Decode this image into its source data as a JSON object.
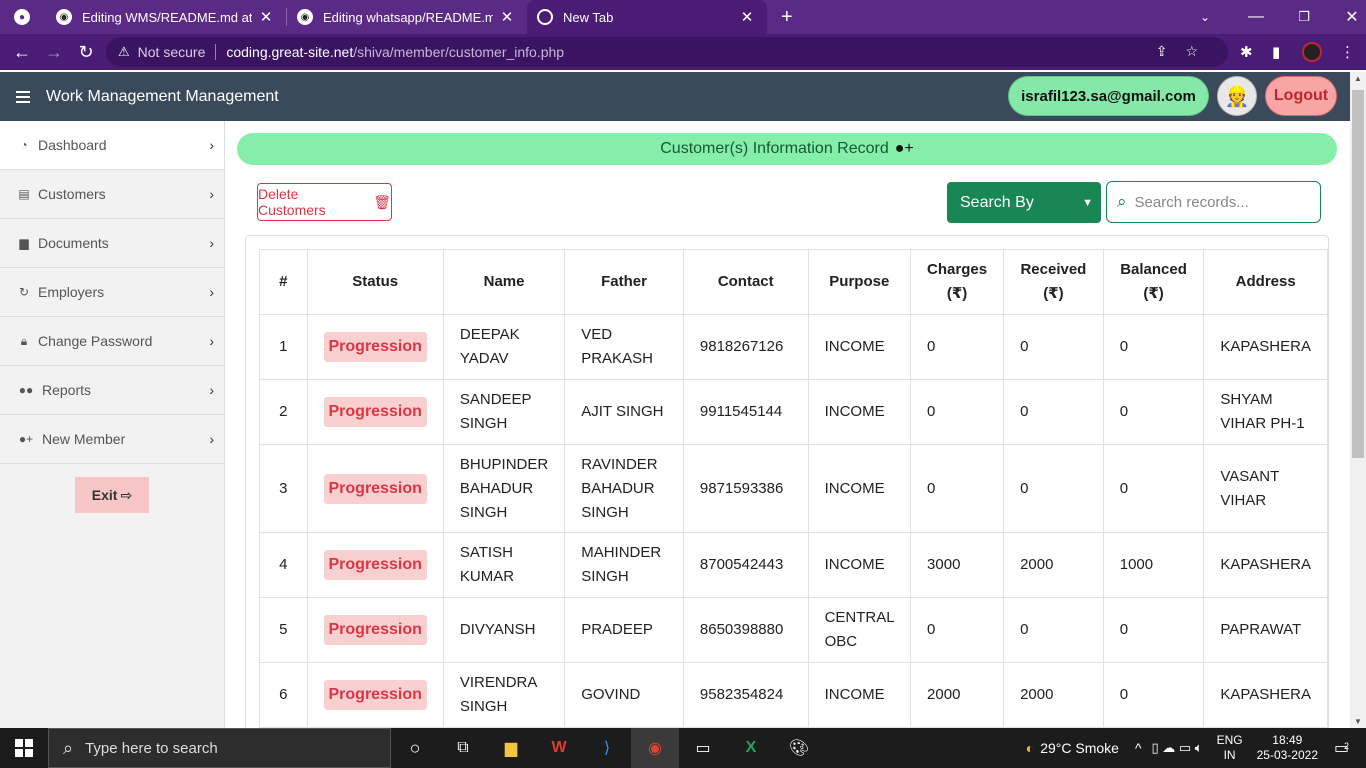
{
  "browser": {
    "tabs": [
      {
        "title": "Editing WMS/README.md at ma",
        "icon": "github-icon"
      },
      {
        "title": "Editing whatsapp/README.md at",
        "icon": "github-icon"
      },
      {
        "title": "New Tab",
        "icon": "chrome-icon"
      }
    ],
    "security": "Not secure",
    "url_host": "coding.great-site.net",
    "url_path": "/shiva/member/customer_info.php"
  },
  "header": {
    "brand": "Work Management Management",
    "email": "israfil123.sa@gmail.com",
    "logout": "Logout"
  },
  "sidebar": {
    "items": [
      {
        "label": "Dashboard",
        "icon": "dashboard-icon"
      },
      {
        "label": "Customers",
        "icon": "customers-icon"
      },
      {
        "label": "Documents",
        "icon": "documents-icon"
      },
      {
        "label": "Employers",
        "icon": "employers-icon"
      },
      {
        "label": "Change Password",
        "icon": "lock-icon"
      },
      {
        "label": "Reports",
        "icon": "users-icon"
      },
      {
        "label": "New Member",
        "icon": "user-plus-icon"
      }
    ],
    "exit": "Exit"
  },
  "main": {
    "banner": "Customer(s) Information Record",
    "delete_button": "Delete Customers",
    "search_by": "Search By",
    "search_placeholder": "Search records..."
  },
  "table": {
    "headers": [
      "#",
      "Status",
      "Name",
      "Father",
      "Contact",
      "Purpose",
      "Charges (₹)",
      "Received (₹)",
      "Balanced (₹)",
      "Address"
    ],
    "rows": [
      [
        "1",
        "Progression",
        "DEEPAK YADAV",
        "VED PRAKASH",
        "9818267126",
        "INCOME",
        "0",
        "0",
        "0",
        "KAPASHERA"
      ],
      [
        "2",
        "Progression",
        "SANDEEP SINGH",
        "AJIT SINGH",
        "9911545144",
        "INCOME",
        "0",
        "0",
        "0",
        "SHYAM VIHAR PH-1"
      ],
      [
        "3",
        "Progression",
        "BHUPINDER BAHADUR SINGH",
        "RAVINDER BAHADUR SINGH",
        "9871593386",
        "INCOME",
        "0",
        "0",
        "0",
        "VASANT VIHAR"
      ],
      [
        "4",
        "Progression",
        "SATISH KUMAR",
        "MAHINDER SINGH",
        "8700542443",
        "INCOME",
        "3000",
        "2000",
        "1000",
        "KAPASHERA"
      ],
      [
        "5",
        "Progression",
        "DIVYANSH",
        "PRADEEP",
        "8650398880",
        "CENTRAL OBC",
        "0",
        "0",
        "0",
        "PAPRAWAT"
      ],
      [
        "6",
        "Progression",
        "VIRENDRA SINGH",
        "GOVIND",
        "9582354824",
        "INCOME",
        "2000",
        "2000",
        "0",
        "KAPASHERA"
      ]
    ]
  },
  "taskbar": {
    "search_placeholder": "Type here to search",
    "weather": "29°C Smoke",
    "lang": "ENG",
    "region": "IN",
    "time": "18:49",
    "date": "25-03-2022",
    "notifications": "2"
  },
  "colors": {
    "browser_frame": "#5b2a86",
    "header": "#3a4a5a",
    "banner": "#86eeab",
    "badge": "#dc3545",
    "search_by": "#198754"
  }
}
